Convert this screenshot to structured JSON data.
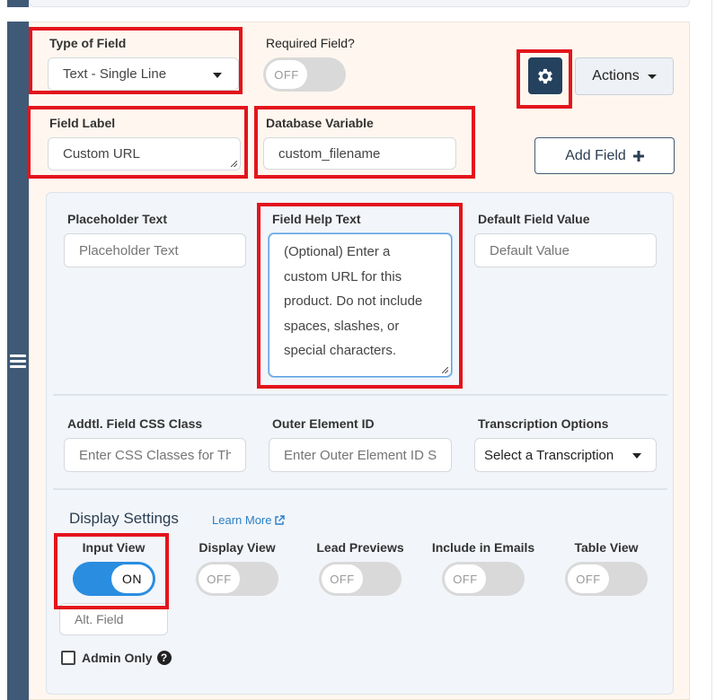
{
  "field": {
    "type_label": "Type of Field",
    "type_value": "Text - Single Line",
    "required_label": "Required Field?",
    "required_state": "OFF",
    "actions_label": "Actions",
    "label_label": "Field Label",
    "label_value": "Custom URL",
    "dbvar_label": "Database Variable",
    "dbvar_value": "custom_filename",
    "add_field_label": "Add Field"
  },
  "advanced": {
    "placeholder_label": "Placeholder Text",
    "placeholder_placeholder": "Placeholder Text",
    "help_label": "Field Help Text",
    "help_value": "(Optional) Enter a custom URL for this product. Do not include spaces, slashes, or special characters.",
    "default_label": "Default Field Value",
    "default_placeholder": "Default Value",
    "css_label": "Addtl. Field CSS Class",
    "css_placeholder": "Enter CSS Classes for Th",
    "outer_label": "Outer Element ID",
    "outer_placeholder": "Enter Outer Element ID S",
    "transcription_label": "Transcription Options",
    "transcription_value": "Select a Transcription"
  },
  "display": {
    "title": "Display Settings",
    "learn_more": "Learn More",
    "input_view": {
      "label": "Input View",
      "state": "ON"
    },
    "display_view": {
      "label": "Display View",
      "state": "OFF"
    },
    "lead_previews": {
      "label": "Lead Previews",
      "state": "OFF"
    },
    "include_emails": {
      "label": "Include in Emails",
      "state": "OFF"
    },
    "table_view": {
      "label": "Table View",
      "state": "OFF"
    },
    "alt_field_placeholder": "Alt. Field",
    "admin_only": "Admin Only"
  },
  "colors": {
    "accent": "#2a8de0",
    "highlight": "#e3141c",
    "sidebar": "#3f5a76",
    "card_bg": "#fff7ef"
  }
}
